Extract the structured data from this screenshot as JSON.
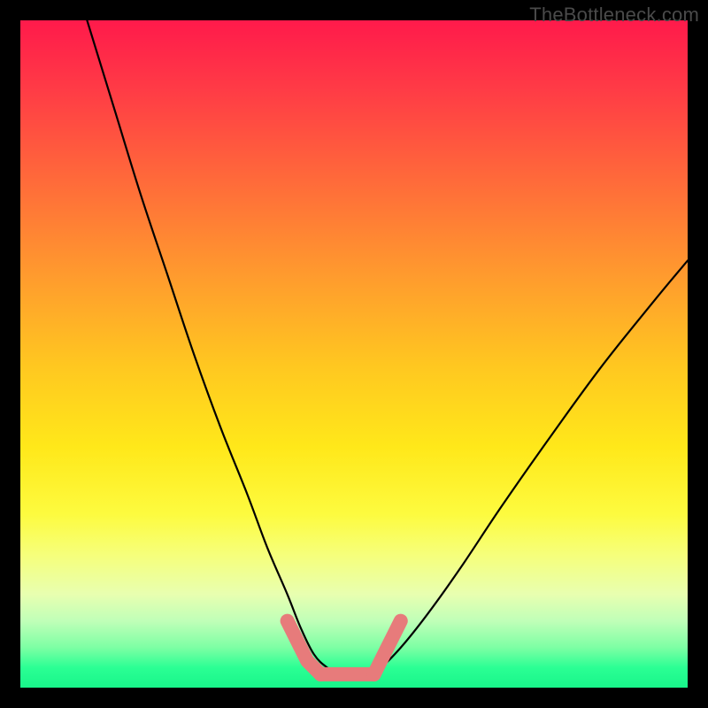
{
  "watermark": "TheBottleneck.com",
  "colors": {
    "background_outer": "#000000",
    "curve_stroke": "#000000",
    "marker_stroke": "#e77b7b",
    "gradient_stops": [
      "#ff1a4b",
      "#ff3a46",
      "#ff6a3a",
      "#ff9a2e",
      "#ffc820",
      "#ffe81a",
      "#fdfb3f",
      "#f6ff7a",
      "#e8ffb0",
      "#c0ffb8",
      "#7dffa4",
      "#2bff94",
      "#18f58a"
    ]
  },
  "chart_data": {
    "type": "line",
    "title": "",
    "xlabel": "",
    "ylabel": "",
    "xlim": [
      0,
      100
    ],
    "ylim": [
      0,
      100
    ],
    "grid": false,
    "series": [
      {
        "name": "bottleneck-curve",
        "x": [
          10,
          14,
          18,
          22,
          26,
          30,
          34,
          37,
          40,
          42,
          44,
          46,
          48,
          50,
          52,
          54,
          57,
          61,
          66,
          72,
          79,
          87,
          95,
          100
        ],
        "y": [
          100,
          87,
          74,
          62,
          50,
          39,
          29,
          21,
          14,
          9,
          5,
          3,
          2,
          2,
          2,
          3,
          6,
          11,
          18,
          27,
          37,
          48,
          58,
          64
        ]
      }
    ],
    "markers": [
      {
        "name": "left-foot",
        "x": [
          40,
          41,
          42,
          43,
          44,
          45
        ],
        "y": [
          10,
          8,
          6,
          4,
          3,
          2
        ]
      },
      {
        "name": "bottom-flat",
        "x": [
          45,
          47,
          49,
          51,
          53
        ],
        "y": [
          2,
          2,
          2,
          2,
          2
        ]
      },
      {
        "name": "right-foot",
        "x": [
          53,
          54,
          55,
          56,
          57
        ],
        "y": [
          2,
          4,
          6,
          8,
          10
        ]
      }
    ]
  }
}
